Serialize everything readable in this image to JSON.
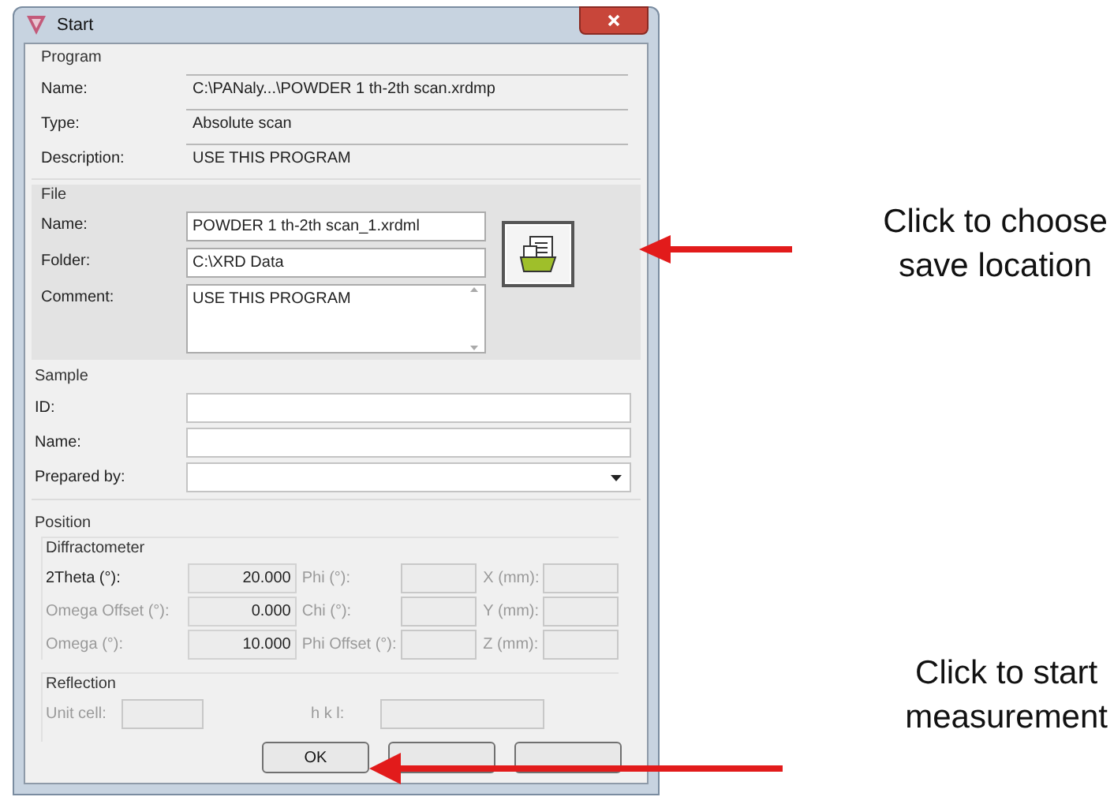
{
  "window": {
    "title": "Start"
  },
  "program": {
    "title": "Program",
    "fields": [
      {
        "label": "Name:",
        "value": "C:\\PANaly...\\POWDER 1 th-2th scan.xrdmp"
      },
      {
        "label": "Type:",
        "value": "Absolute scan"
      },
      {
        "label": "Description:",
        "value": "USE THIS PROGRAM"
      }
    ]
  },
  "file": {
    "title": "File",
    "fields": [
      {
        "label": "Name:",
        "value": "POWDER 1 th-2th scan_1.xrdml",
        "kind": "text"
      },
      {
        "label": "Folder:",
        "value": "C:\\XRD Data",
        "kind": "text"
      },
      {
        "label": "Comment:",
        "value": "USE THIS PROGRAM",
        "kind": "memo"
      }
    ]
  },
  "sample": {
    "title": "Sample",
    "fields": [
      {
        "label": "ID:",
        "kind": "text"
      },
      {
        "label": "Name:",
        "kind": "text"
      },
      {
        "label": "Prepared by:",
        "kind": "dropdown"
      }
    ]
  },
  "position": {
    "title": "Position",
    "diffractometer": {
      "title": "Diffractometer",
      "rows": [
        [
          {
            "label": "2Theta (°):",
            "value": "20.000",
            "disabled": false
          },
          {
            "label": "Phi (°):",
            "disabled": true
          },
          {
            "label": "X (mm):",
            "disabled": true
          }
        ],
        [
          {
            "label": "Omega Offset (°):",
            "value": "0.000",
            "disabled": true
          },
          {
            "label": "Chi (°):",
            "disabled": true
          },
          {
            "label": "Y (mm):",
            "disabled": true
          }
        ],
        [
          {
            "label": "Omega (°):",
            "value": "10.000",
            "disabled": true
          },
          {
            "label": "Phi Offset (°):",
            "disabled": true
          },
          {
            "label": "Z (mm):",
            "disabled": true
          }
        ]
      ]
    },
    "reflection": {
      "title": "Reflection",
      "fields": [
        {
          "label": "Unit cell:",
          "disabled": true
        },
        {
          "label": "h k l:",
          "disabled": true
        }
      ]
    }
  },
  "buttons": [
    {
      "kind": "labelled",
      "label": "OK"
    },
    {
      "kind": "covered"
    },
    {
      "kind": "covered"
    }
  ],
  "annotations": [
    {
      "lines": [
        "Click to choose",
        "save location"
      ]
    },
    {
      "lines": [
        "Click to start",
        "measurement"
      ]
    }
  ]
}
